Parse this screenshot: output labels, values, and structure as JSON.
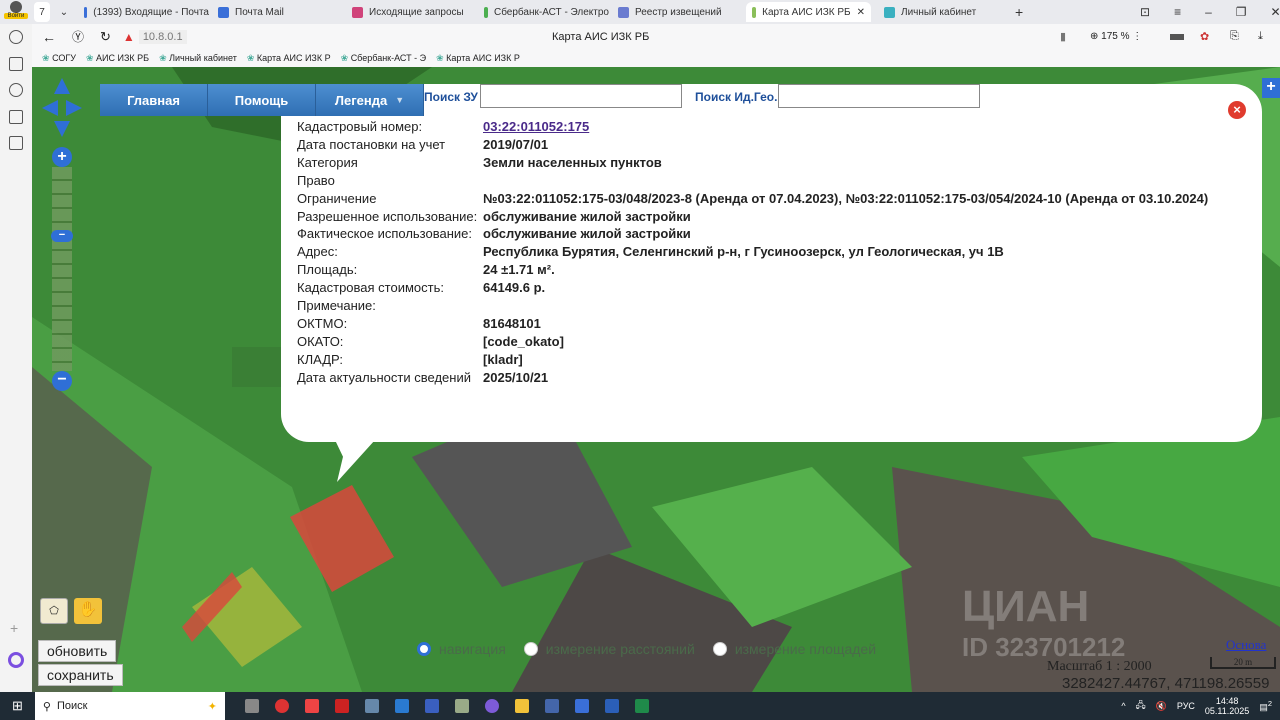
{
  "browser": {
    "tab_count": "7",
    "tabs": [
      {
        "label": "(1393) Входящие - Почта",
        "color": "#3a6fd8"
      },
      {
        "label": "Почта Mail",
        "color": "#3a6fd8"
      },
      {
        "label": "Исходящие запросы",
        "color": "#d0437a"
      },
      {
        "label": "Сбербанк-АСТ - Электро",
        "color": "#4caf50"
      },
      {
        "label": "Реестр извещений",
        "color": "#6a7bd0"
      },
      {
        "label": "Карта АИС ИЗК РБ",
        "color": "#8bbf5a",
        "active": true
      },
      {
        "label": "Личный кабинет",
        "color": "#3ab0c0"
      }
    ],
    "login_label": "Войти",
    "address": "10.8.0.1",
    "page_title": "Карта АИС ИЗК РБ",
    "zoom": "175 %",
    "bookmarks": [
      "СОГУ",
      "АИС ИЗК РБ",
      "Личный кабинет",
      "Карта АИС ИЗК Р",
      "Сбербанк-АСТ - Э",
      "Карта АИС ИЗК Р"
    ]
  },
  "menu": {
    "items": [
      "Главная",
      "Помощь",
      "Легенда"
    ]
  },
  "search": {
    "zu_label": "Поиск ЗУ",
    "zu_value": "",
    "geo_label": "Поиск Ид.Гео.",
    "geo_value": ""
  },
  "popup": {
    "rows": [
      {
        "k": "Кадастровый номер:",
        "v": "03:22:011052:175",
        "link": true
      },
      {
        "k": "Дата постановки на учет",
        "v": "2019/07/01"
      },
      {
        "k": "Категория",
        "v": "Земли населенных пунктов"
      },
      {
        "k": "Право",
        "v": ""
      },
      {
        "k": "Ограничение",
        "v": "№03:22:011052:175-03/048/2023-8 (Аренда от 07.04.2023), №03:22:011052:175-03/054/2024-10 (Аренда от 03.10.2024)"
      },
      {
        "k": "Разрешенное использование:",
        "v": "обслуживание жилой застройки"
      },
      {
        "k": "Фактическое использование:",
        "v": "обслуживание жилой застройки"
      },
      {
        "k": "Адрес:",
        "v": "Республика Бурятия, Селенгинский р-н, г Гусиноозерск, ул Геологическая, уч 1В"
      },
      {
        "k": "Площадь:",
        "v": "24 ±1.71 м²."
      },
      {
        "k": "Кадастровая стоимость:",
        "v": "64149.6 р."
      },
      {
        "k": "Примечание:",
        "v": ""
      },
      {
        "k": "ОКТМО:",
        "v": "81648101"
      },
      {
        "k": "ОКАТО:",
        "v": "[code_okato]"
      },
      {
        "k": "КЛАДР:",
        "v": "[kladr]"
      },
      {
        "k": "Дата актуальности сведений",
        "v": "2025/10/21"
      }
    ]
  },
  "controls": {
    "refresh": "обновить",
    "save": "сохранить",
    "modes": [
      "навигация",
      "измерение расстояний",
      "измерение площадей"
    ],
    "selected_mode": 0
  },
  "map_info": {
    "base_link": "Основа",
    "scale": "Масштаб 1 : 2000",
    "scalebar": "20 m",
    "coords": "3282427.44767, 471198.26559",
    "watermark": "ЦИАН",
    "watermark_id": "ID 323701212"
  },
  "taskbar": {
    "search": "Поиск",
    "lang": "РУС",
    "time": "14:48",
    "date": "05.11.2025",
    "notif": "2"
  }
}
